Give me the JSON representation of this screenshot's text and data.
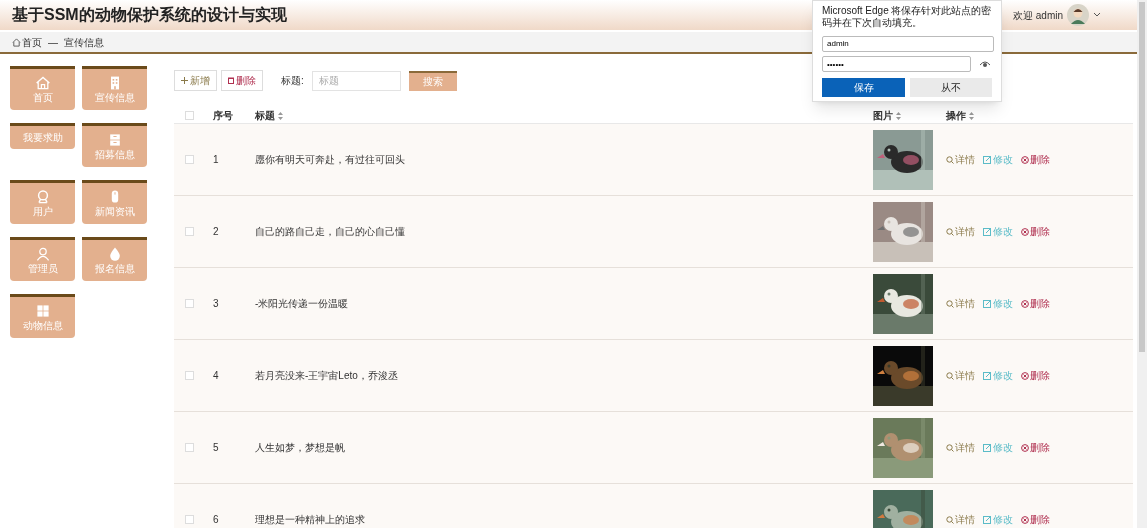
{
  "header": {
    "title": "基于SSM的动物保护系统的设计与实现",
    "welcome": "欢迎 admin"
  },
  "breadcrumb": {
    "home": "首页",
    "separator": "—",
    "current": "宣传信息"
  },
  "sidebar": {
    "items": [
      {
        "label": "首页"
      },
      {
        "label": "宣传信息"
      },
      {
        "label": "我要求助"
      },
      {
        "label": "招募信息"
      },
      {
        "label": "用户"
      },
      {
        "label": "新闻资讯"
      },
      {
        "label": "管理员"
      },
      {
        "label": "报名信息"
      },
      {
        "label": "动物信息"
      }
    ]
  },
  "toolbar": {
    "add": "新增",
    "delete": "删除",
    "search_label": "标题:",
    "search_placeholder": "标题",
    "search_button": "搜索"
  },
  "table": {
    "select_all_checked": false,
    "columns": [
      "序号",
      "标题",
      "图片",
      "操作"
    ],
    "rows": [
      {
        "checked": false,
        "number": "1",
        "title": "愿你有明天可奔赴，有过往可回头",
        "picture": {
          "kind": "picture"
        },
        "actions": [
          "详情",
          "修改",
          "删除"
        ]
      },
      {
        "checked": false,
        "number": "2",
        "title": "自己的路自己走，自己的心自己懂",
        "picture": {
          "kind": "picture"
        },
        "actions": [
          "详情",
          "修改",
          "删除"
        ]
      },
      {
        "checked": false,
        "number": "3",
        "title": "-米阳光传递一份温暖",
        "picture": {
          "kind": "picture"
        },
        "actions": [
          "详情",
          "修改",
          "删除"
        ]
      },
      {
        "checked": false,
        "number": "4",
        "title": "若月亮没来-王宇宙Leto，乔浚丞",
        "picture": {
          "kind": "picture"
        },
        "actions": [
          "详情",
          "修改",
          "删除"
        ]
      },
      {
        "checked": false,
        "number": "5",
        "title": "人生如梦，梦想是帆",
        "picture": {
          "kind": "picture"
        },
        "actions": [
          "详情",
          "修改",
          "删除"
        ]
      },
      {
        "checked": false,
        "number": "6",
        "title": "理想是一种精神上的追求",
        "picture": {
          "kind": "picture"
        },
        "actions": [
          "详情",
          "修改",
          "删除"
        ]
      }
    ]
  },
  "password_prompt": {
    "message": "Microsoft Edge 将保存针对此站点的密码并在下次自动填充。",
    "username": "admin",
    "password": "••••••",
    "save": "保存",
    "never": "从不"
  }
}
